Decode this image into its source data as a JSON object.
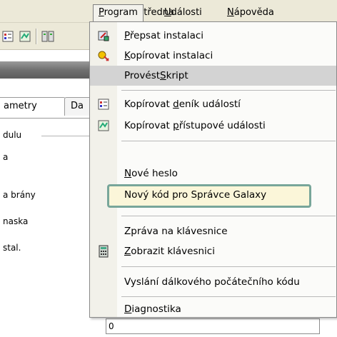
{
  "menubar": {
    "ustredna": {
      "pre": "",
      "acc": "Ú",
      "post": "středna"
    },
    "program": {
      "pre": "",
      "acc": "P",
      "post": "rogram"
    },
    "udalosti": {
      "pre": "",
      "acc": "U",
      "post": "dálosti"
    },
    "napoveda": {
      "pre": "",
      "acc": "N",
      "post": "ápověda"
    }
  },
  "tabs": {
    "tab1": "ametry",
    "tab2": "Da"
  },
  "panel": {
    "labels": [
      "dulu",
      "a",
      "a brány",
      "naska",
      "stal."
    ],
    "bottom_value": "0"
  },
  "menu": {
    "items": [
      {
        "pre": "",
        "acc": "P",
        "post": "řepsat instalaci",
        "icon": "overwrite-install-icon"
      },
      {
        "pre": "",
        "acc": "K",
        "post": "opírovat instalaci",
        "icon": "copy-install-icon"
      },
      {
        "pre": "Provést",
        "acc": "S",
        "post": "kript",
        "icon": ""
      },
      {
        "pre": "Kopírovat ",
        "acc": "d",
        "post": "eník událostí",
        "icon": "event-log-icon"
      },
      {
        "pre": "Kopírovat ",
        "acc": "p",
        "post": "řístupové události",
        "icon": "access-events-icon"
      },
      {
        "pre": "",
        "acc": "N",
        "post": "ové heslo",
        "icon": ""
      },
      {
        "pre": "Nový kód pro Správce Galaxy",
        "acc": "",
        "post": "",
        "icon": ""
      },
      {
        "pre": "Zpráva na klávesnice",
        "acc": "",
        "post": "",
        "icon": ""
      },
      {
        "pre": "",
        "acc": "Z",
        "post": "obrazit klávesnici",
        "icon": "keypad-icon"
      },
      {
        "pre": "Vyslání dálkového počátečního kódu",
        "acc": "",
        "post": "",
        "icon": ""
      },
      {
        "pre": "",
        "acc": "D",
        "post": "iagnostika",
        "icon": "submenu-arrow-icon"
      }
    ]
  },
  "colors": {
    "highlight_border": "#78a69a",
    "highlight_fill": "#fbf6d9",
    "hover_fill": "#d3d3d3"
  }
}
